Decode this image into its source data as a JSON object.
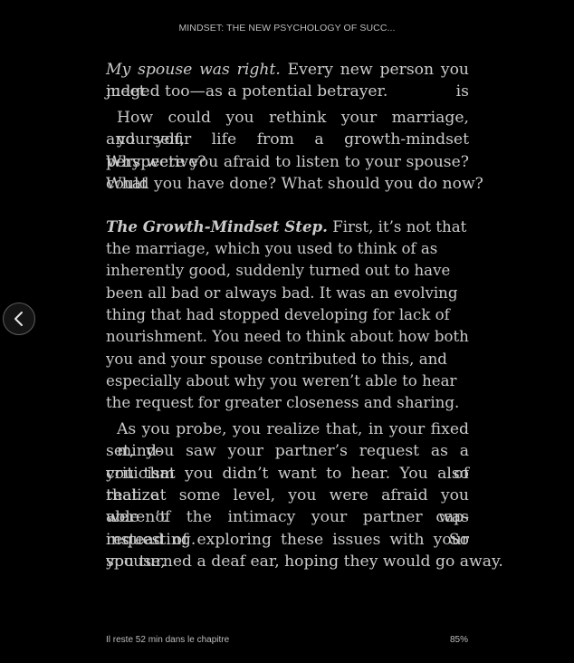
{
  "header": {
    "book_title": "MINDSET: THE NEW PSYCHOLOGY OF SUCC..."
  },
  "page": {
    "p1": {
      "italic": "My spouse was right.",
      "rest": "Every new person you meet is",
      "line2": "judged too—as a potential betrayer."
    },
    "p2": {
      "lines": [
        "How could you rethink your marriage, yourself,",
        "and your life from a growth-mindset perspective?",
        "Why were you afraid to listen to your spouse? What",
        "could you have done? What should you do now?"
      ]
    },
    "p3": {
      "bold_italic": "The Growth-Mindset Step.",
      "first_rest": "First, it’s not that",
      "lines": [
        "the marriage, which you used to think of as",
        "inherently good, suddenly turned out to have",
        "been all bad or always bad. It was an evolving",
        "thing that had stopped developing for lack of",
        "nourishment. You need to think about how both",
        "you and your spouse contributed to this, and",
        "especially about why you weren’t able to hear",
        "the request for greater closeness and sharing."
      ]
    },
    "p4": {
      "lines": [
        "As you probe, you realize that, in your fixed mind-",
        "set, you saw your partner’s request as a criticism of",
        "you that you didn’t want to hear. You also realize",
        "that at some level, you were afraid you weren’t cap-",
        "able of the intimacy your partner was requesting. So",
        "instead of exploring these issues with your spouse,",
        "you turned a deaf ear, hoping they would go away."
      ]
    }
  },
  "footer": {
    "time_left": "Il reste 52 min dans le chapitre",
    "progress": "85%"
  },
  "icons": {
    "prev": "chevron-left-icon"
  },
  "colors": {
    "background": "#000000",
    "text": "#cbcbcb",
    "button_border": "#5d5d5d"
  }
}
